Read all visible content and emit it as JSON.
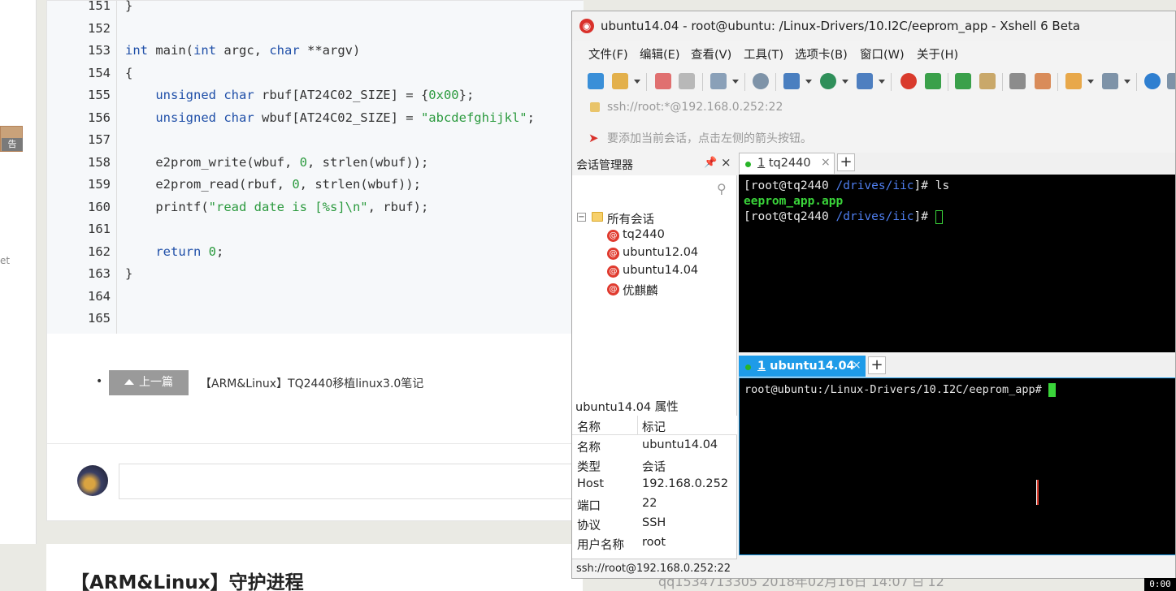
{
  "blog": {
    "side_thumb_label": "告",
    "side_text": "et",
    "code_lines": [
      {
        "no": "151",
        "code": "}"
      },
      {
        "no": "152",
        "code": ""
      },
      {
        "no": "153",
        "code": "int main(int argc, char **argv)"
      },
      {
        "no": "154",
        "code": "{"
      },
      {
        "no": "155",
        "code": "    unsigned char rbuf[AT24C02_SIZE] = {0x00};"
      },
      {
        "no": "156",
        "code": "    unsigned char wbuf[AT24C02_SIZE] = \"abcdefghijkl\";"
      },
      {
        "no": "157",
        "code": ""
      },
      {
        "no": "158",
        "code": "    e2prom_write(wbuf, 0, strlen(wbuf));"
      },
      {
        "no": "159",
        "code": "    e2prom_read(rbuf, 0, strlen(wbuf));"
      },
      {
        "no": "160",
        "code": "    printf(\"read date is [%s]\\n\", rbuf);"
      },
      {
        "no": "161",
        "code": ""
      },
      {
        "no": "162",
        "code": "    return 0;"
      },
      {
        "no": "163",
        "code": "}"
      },
      {
        "no": "164",
        "code": ""
      },
      {
        "no": "165",
        "code": ""
      }
    ],
    "prev_bullet": "•",
    "prev_button_label": "上一篇",
    "prev_button_icon": "chevron-up-icon",
    "prev_title": "【ARM&Linux】TQ2440移植linux3.0笔记",
    "next_post_title": "【ARM&Linux】守护进程",
    "next_post_meta": "qq1534713305   2018年02月16日 14:07   ⊟ 12"
  },
  "xshell": {
    "title": "ubuntu14.04 - root@ubuntu: /Linux-Drivers/10.I2C/eeprom_app - Xshell 6 Beta",
    "menu": [
      "文件(F)",
      "编辑(E)",
      "查看(V)",
      "工具(T)",
      "选项卡(B)",
      "窗口(W)",
      "关于(H)"
    ],
    "address": "ssh://root:*@192.168.0.252:22",
    "hint": "要添加当前会话，点击左侧的箭头按钮。",
    "session_manager": {
      "title": "会话管理器",
      "pin": "📌",
      "close": "×",
      "root_expander": "⊟",
      "root_label": "所有会话",
      "sessions": [
        "tq2440",
        "ubuntu12.04",
        "ubuntu14.04",
        "优麒麟"
      ],
      "props_title": "ubuntu14.04 属性",
      "props_headers": [
        "名称",
        "标记"
      ],
      "props": [
        {
          "k": "名称",
          "v": "ubuntu14.04"
        },
        {
          "k": "类型",
          "v": "会话"
        },
        {
          "k": "Host",
          "v": "192.168.0.252"
        },
        {
          "k": "端口",
          "v": "22"
        },
        {
          "k": "协议",
          "v": "SSH"
        },
        {
          "k": "用户名称",
          "v": "root"
        }
      ],
      "status": "ssh://root@192.168.0.252:22"
    },
    "pane1": {
      "tab_num": "1",
      "tab_label": "tq2440",
      "tab_close": "×",
      "add": "+",
      "line1_prompt": "[root@tq2440 ",
      "line1_path": "/drives/iic",
      "line1_cmd": "]# ls",
      "line2": "eeprom_app.app",
      "line3_prompt": "[root@tq2440 ",
      "line3_path": "/drives/iic",
      "line3_end": "]# "
    },
    "pane2": {
      "tab_num": "1",
      "tab_label": "ubuntu14.04",
      "tab_close": "×",
      "add": "+",
      "line1": "root@ubuntu:/Linux-Drivers/10.I2C/eeprom_app# "
    }
  },
  "clock": "0:00",
  "colors": {
    "active_tab": "#1e9be8",
    "terminal_bg": "#000000",
    "ls_output": "#3ad43a",
    "path": "#4f7ff0"
  }
}
